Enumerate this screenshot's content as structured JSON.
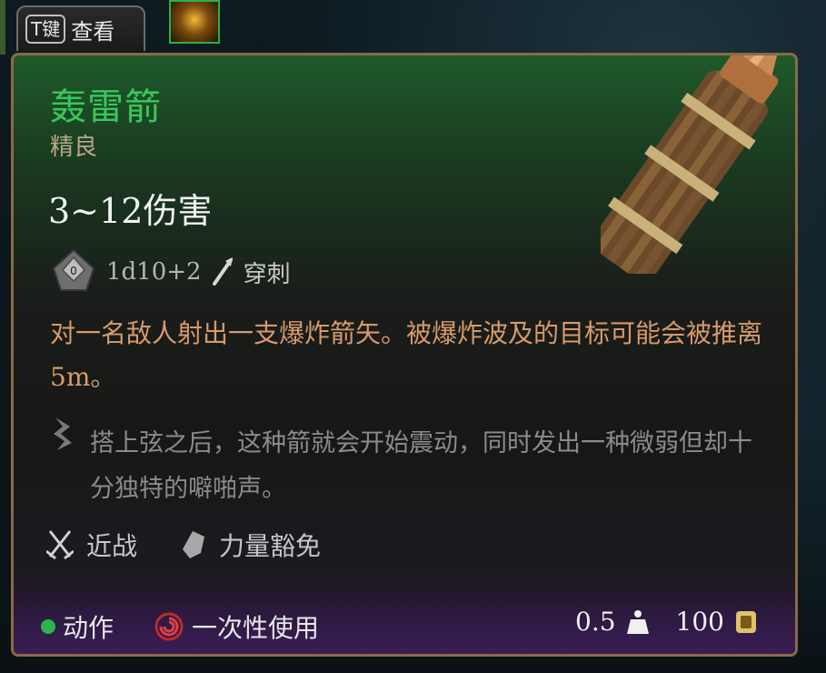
{
  "hotkey": {
    "key": "T键",
    "label": "查看"
  },
  "item": {
    "name": "轰雷箭",
    "rarity": "精良",
    "damage": "3~12伤害",
    "dice": "1d10+2",
    "damage_type": "穿刺",
    "description": "对一名敌人射出一支爆炸箭矢。被爆炸波及的目标可能会被推离5m。",
    "flavor": "搭上弦之后，这种箭就会开始震动，同时发出一种微弱但却十分独特的噼啪声。",
    "tags": [
      "近战",
      "力量豁免"
    ],
    "footer": {
      "action": "动作",
      "consumable": "一次性使用",
      "weight": "0.5",
      "price": "100"
    }
  },
  "colors": {
    "title": "#39c75a",
    "border": "#8a6a45",
    "description": "#d69a6c",
    "action_dot": "#2db34a"
  },
  "icons": {
    "dice": "d10-die-icon",
    "damage_type": "arrow-pierce-icon",
    "flavor": "quill-icon",
    "tag_melee": "crossed-swords-icon",
    "tag_save": "shield-icon",
    "consumable": "spiral-icon",
    "weight": "weight-icon",
    "price": "coin-icon"
  }
}
